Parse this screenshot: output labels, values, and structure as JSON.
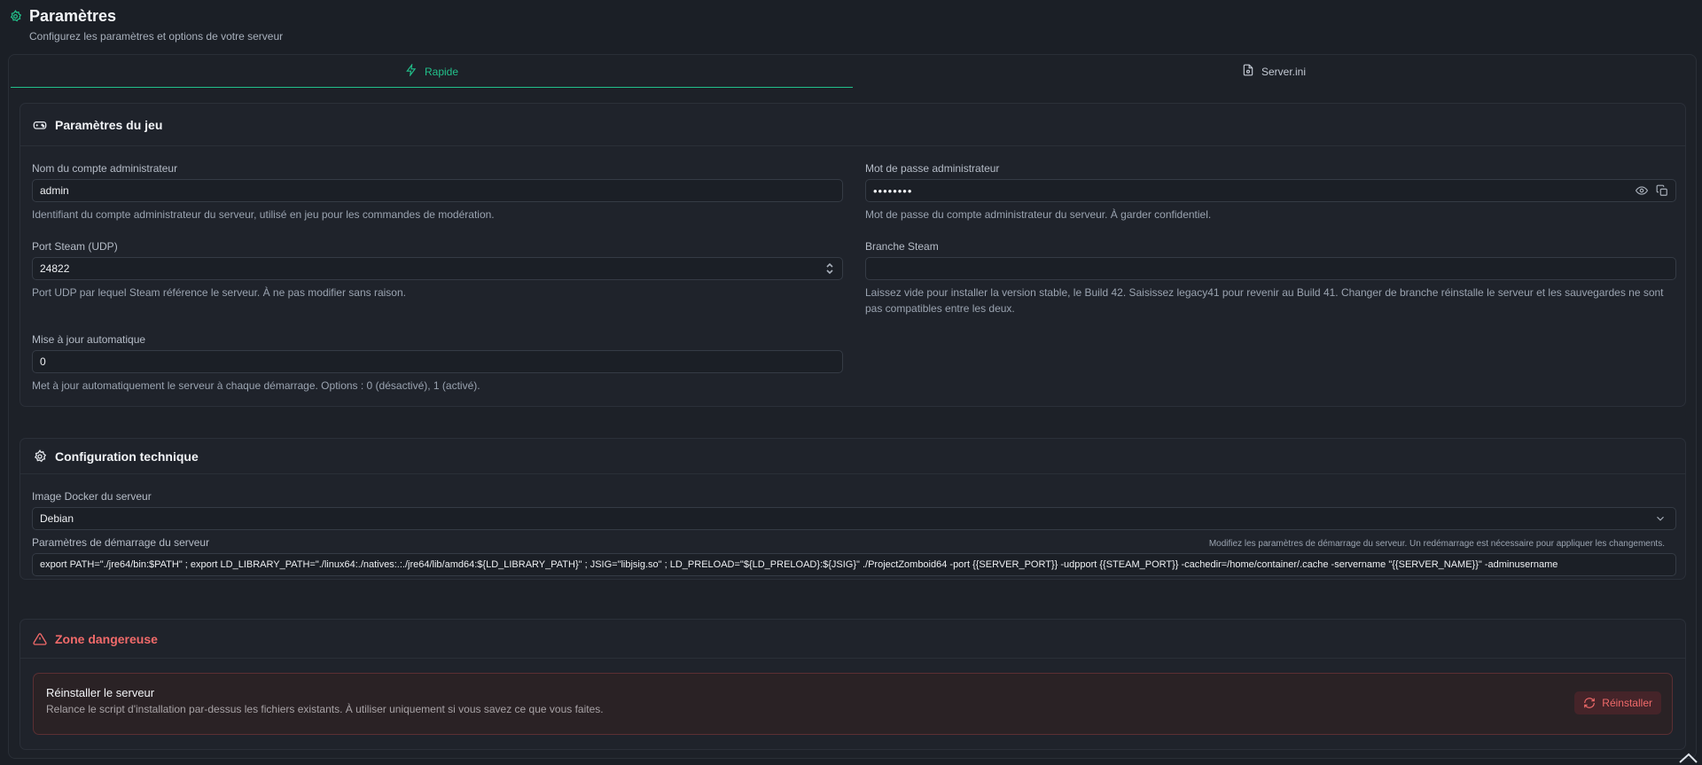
{
  "header": {
    "title": "Paramètres",
    "subtitle": "Configurez les paramètres et options de votre serveur"
  },
  "tabs": [
    {
      "label": "Rapide",
      "active": true,
      "icon": "bolt-icon"
    },
    {
      "label": "Server.ini",
      "active": false,
      "icon": "file-settings-icon"
    }
  ],
  "game_settings": {
    "title": "Paramètres du jeu",
    "icon": "gamepad-icon",
    "admin_name": {
      "label": "Nom du compte administrateur",
      "value": "admin",
      "help": "Identifiant du compte administrateur du serveur, utilisé en jeu pour les commandes de modération."
    },
    "admin_password": {
      "label": "Mot de passe administrateur",
      "value": "••••••••",
      "help": "Mot de passe du compte administrateur du serveur. À garder confidentiel."
    },
    "steam_port": {
      "label": "Port Steam (UDP)",
      "value": "24822",
      "help": "Port UDP par lequel Steam référence le serveur. À ne pas modifier sans raison."
    },
    "steam_branch": {
      "label": "Branche Steam",
      "value": "",
      "help": "Laissez vide pour installer la version stable, le Build 42. Saisissez legacy41 pour revenir au Build 41. Changer de branche réinstalle le serveur et les sauvegardes ne sont pas compatibles entre les deux."
    },
    "auto_update": {
      "label": "Mise à jour automatique",
      "value": "0",
      "help": "Met à jour automatiquement le serveur à chaque démarrage. Options : 0 (désactivé), 1 (activé)."
    }
  },
  "tech_config": {
    "title": "Configuration technique",
    "icon": "gear-icon",
    "docker_image": {
      "label": "Image Docker du serveur",
      "value": "Debian"
    },
    "startup": {
      "label": "Paramètres de démarrage du serveur",
      "note": "Modifiez les paramètres de démarrage du serveur. Un redémarrage est nécessaire pour appliquer les changements.",
      "value": "export PATH=\"./jre64/bin:$PATH\" ; export LD_LIBRARY_PATH=\"./linux64:./natives:.:./jre64/lib/amd64:${LD_LIBRARY_PATH}\" ; JSIG=\"libjsig.so\" ; LD_PRELOAD=\"${LD_PRELOAD}:${JSIG}\" ./ProjectZomboid64  -port {{SERVER_PORT}} -udpport {{STEAM_PORT}} -cachedir=/home/container/.cache -servername \"{{SERVER_NAME}}\" -adminusername"
    }
  },
  "danger": {
    "title": "Zone dangereuse",
    "icon": "warning-triangle-icon",
    "reinstall_title": "Réinstaller le serveur",
    "reinstall_desc": "Relance le script d'installation par-dessus les fichiers existants. À utiliser uniquement si vous savez ce que vous faites.",
    "reinstall_button": "Réinstaller"
  },
  "colors": {
    "accent": "#22c08a",
    "danger": "#f06a6a",
    "background": "#1b1f26"
  }
}
